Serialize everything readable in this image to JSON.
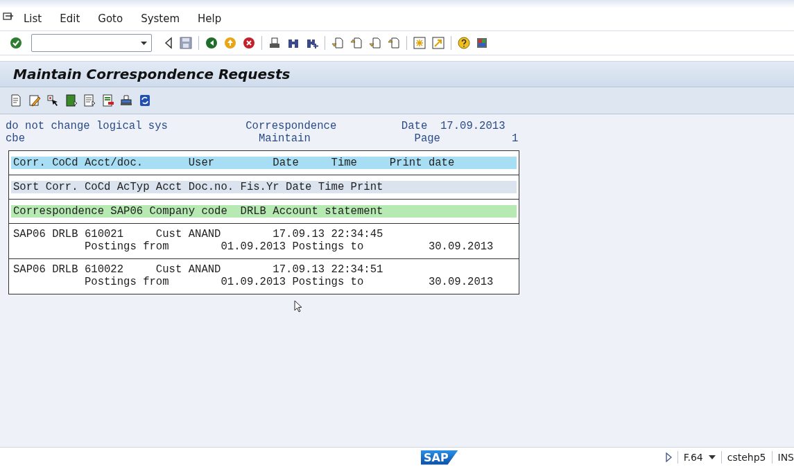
{
  "menu": [
    {
      "label": "List"
    },
    {
      "label": "Edit"
    },
    {
      "label": "Goto"
    },
    {
      "label": "System"
    },
    {
      "label": "Help"
    }
  ],
  "title": "Maintain Correspondence Requests",
  "header_lines": [
    "do not change logical sys            Correspondence          Date  17.09.2013",
    "cbe                                    Maintain                Page           1"
  ],
  "blocks": [
    {
      "kind": "heading",
      "lines": [
        "Corr. CoCd Acct/doc.       User         Date     Time     Print date"
      ]
    },
    {
      "kind": "sort",
      "lines": [
        "Sort Corr. CoCd AcTyp Acct Doc.no. Fis.Yr Date Time Print"
      ]
    },
    {
      "kind": "group",
      "lines": [
        "Correspondence SAP06 Company code  DRLB Account statement"
      ]
    },
    {
      "kind": "data",
      "lines": [
        "SAP06 DRLB 610021     Cust ANAND        17.09.13 22:34:45",
        "           Postings from        01.09.2013 Postings to          30.09.2013"
      ]
    },
    {
      "kind": "data",
      "lines": [
        "SAP06 DRLB 610022     Cust ANAND        17.09.13 22:34:51",
        "           Postings from        01.09.2013 Postings to          30.09.2013"
      ]
    }
  ],
  "status_bar": {
    "logo": "SAP",
    "transaction": "F.64",
    "server": "cstehp5",
    "mode": "INS"
  }
}
